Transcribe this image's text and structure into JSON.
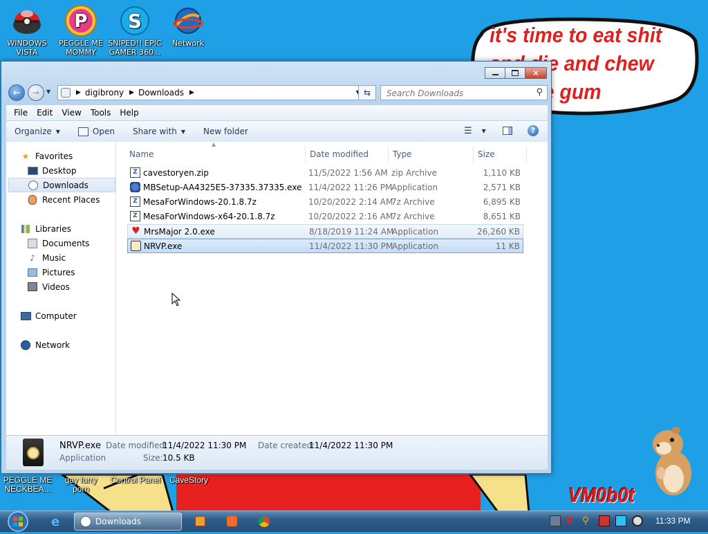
{
  "desktop": {
    "icons": [
      {
        "label": "WINDOWS VISTA"
      },
      {
        "label": "PEGGLE ME MOMMY"
      },
      {
        "label": "SNIPED!! EPIC GAMER 360..."
      },
      {
        "label": "Network"
      }
    ],
    "bubble_text": "it's time to eat shit and die and chew bubble gum",
    "bottom_icons": [
      {
        "label": "PEGGLE ME NECKBEA..."
      },
      {
        "label": "gay furry porn"
      },
      {
        "label": "Control Panel"
      },
      {
        "label": "CaveStory"
      }
    ],
    "watermark": "VM0b0t"
  },
  "window": {
    "address": {
      "segments": [
        "digibrony",
        "Downloads"
      ]
    },
    "search_placeholder": "Search Downloads",
    "menu": [
      "File",
      "Edit",
      "View",
      "Tools",
      "Help"
    ],
    "toolbar": {
      "organize": "Organize",
      "open": "Open",
      "share_with": "Share with",
      "new_folder": "New folder"
    },
    "nav": {
      "favorites": "Favorites",
      "desktop": "Desktop",
      "downloads": "Downloads",
      "recent": "Recent Places",
      "libraries": "Libraries",
      "documents": "Documents",
      "music": "Music",
      "pictures": "Pictures",
      "videos": "Videos",
      "computer": "Computer",
      "network": "Network"
    },
    "columns": {
      "name": "Name",
      "date": "Date modified",
      "type": "Type",
      "size": "Size"
    },
    "files": [
      {
        "name": "cavestoryen.zip",
        "date": "11/5/2022 1:56 AM",
        "type": "zip Archive",
        "size": "1,110 KB",
        "icon": "archive-icon"
      },
      {
        "name": "MBSetup-AA4325E5-37335.37335.exe",
        "date": "11/4/2022 11:26 PM",
        "type": "Application",
        "size": "2,571 KB",
        "icon": "installer-icon"
      },
      {
        "name": "MesaForWindows-20.1.8.7z",
        "date": "10/20/2022 2:14 AM",
        "type": "7z Archive",
        "size": "6,895 KB",
        "icon": "archive-icon"
      },
      {
        "name": "MesaForWindows-x64-20.1.8.7z",
        "date": "10/20/2022 2:16 AM",
        "type": "7z Archive",
        "size": "8,651 KB",
        "icon": "archive-icon"
      },
      {
        "name": "MrsMajor 2.0.exe",
        "date": "8/18/2019 11:24 AM",
        "type": "Application",
        "size": "26,260 KB",
        "icon": "heart-icon"
      },
      {
        "name": "NRVP.exe",
        "date": "11/4/2022 11:30 PM",
        "type": "Application",
        "size": "11 KB",
        "icon": "clock-app-icon"
      }
    ],
    "details": {
      "name": "NRVP.exe",
      "type": "Application",
      "date_modified_label": "Date modified:",
      "date_modified": "11/4/2022 11:30 PM",
      "date_created_label": "Date created:",
      "date_created": "11/4/2022 11:30 PM",
      "size_label": "Size:",
      "size": "10.5 KB"
    }
  },
  "taskbar": {
    "active_item": "Downloads",
    "clock": "11:33 PM"
  }
}
